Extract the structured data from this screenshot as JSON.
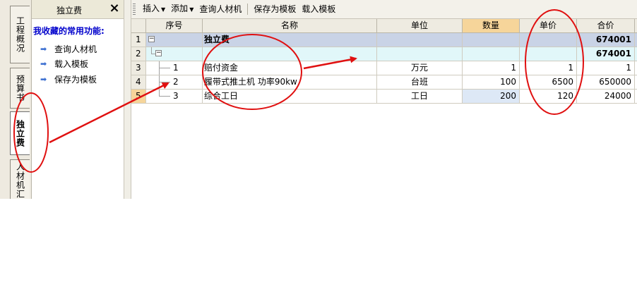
{
  "vertical_tabs": [
    {
      "label": "工程概况",
      "active": false
    },
    {
      "label": "预算书",
      "active": false
    },
    {
      "label": "独立费",
      "active": true
    },
    {
      "label": "人材机汇",
      "active": false
    }
  ],
  "left_panel": {
    "title": "独立费",
    "favorites_label": "我收藏的常用功能:",
    "items": [
      "查询人材机",
      "载入模板",
      "保存为模板"
    ]
  },
  "toolbar": {
    "insert": "插入",
    "add": "添加",
    "query": "查询人材机",
    "save_template": "保存为模板",
    "load_template": "载入模板"
  },
  "table": {
    "headers": {
      "seq": "序号",
      "name": "名称",
      "unit": "单位",
      "qty": "数量",
      "price": "单价",
      "total": "合价"
    },
    "rows": [
      {
        "idx": "1",
        "seq": "",
        "name": "独立费",
        "unit": "",
        "qty": "",
        "price": "",
        "total": "674001"
      },
      {
        "idx": "2",
        "seq": "",
        "name": "",
        "unit": "",
        "qty": "",
        "price": "",
        "total": "674001"
      },
      {
        "idx": "3",
        "seq": "1",
        "name": "赔付资金",
        "unit": "万元",
        "qty": "1",
        "price": "1",
        "total": "1"
      },
      {
        "idx": "4",
        "seq": "2",
        "name": "履带式推土机 功率90kw",
        "unit": "台班",
        "qty": "100",
        "price": "6500",
        "total": "650000"
      },
      {
        "idx": "5",
        "seq": "3",
        "name": "综合工日",
        "unit": "工日",
        "qty": "200",
        "price": "120",
        "total": "24000"
      }
    ]
  },
  "colors": {
    "annotation": "#e01010",
    "qty_header": "#f6d59a",
    "row1_bg": "#c9d3e6",
    "row2_bg": "#e1f7f9"
  }
}
